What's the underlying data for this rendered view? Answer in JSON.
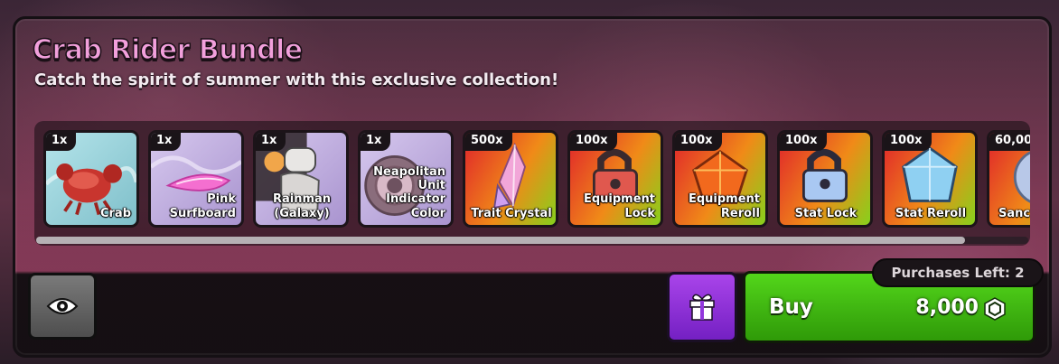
{
  "bundle": {
    "title": "Crab Rider Bundle",
    "subtitle": "Catch the spirit of summer with this exclusive collection!"
  },
  "items": [
    {
      "qty": "1x",
      "name": "Crab",
      "icon": "crab-icon",
      "bg": "#9fd2d8"
    },
    {
      "qty": "1x",
      "name": "Pink Surfboard",
      "icon": "surfboard-icon",
      "bg": "#c7b8e0"
    },
    {
      "qty": "1x",
      "name": "Rainman (Galaxy)",
      "icon": "rainman-unit-icon",
      "bg": "#c7b8e0"
    },
    {
      "qty": "1x",
      "name": "Neapolitan Unit Indicator Color",
      "icon": "unit-indicator-icon",
      "bg": "#c7b8e0"
    },
    {
      "qty": "500x",
      "name": "Trait Crystal",
      "icon": "crystal-icon",
      "bg": "rainbow"
    },
    {
      "qty": "100x",
      "name": "Equipment Lock",
      "icon": "lock-icon",
      "bg": "rainbow"
    },
    {
      "qty": "100x",
      "name": "Equipment Reroll",
      "icon": "reroll-gem-icon",
      "bg": "rainbow"
    },
    {
      "qty": "100x",
      "name": "Stat Lock",
      "icon": "stat-lock-icon",
      "bg": "rainbow"
    },
    {
      "qty": "100x",
      "name": "Stat Reroll",
      "icon": "stat-reroll-icon",
      "bg": "rainbow"
    },
    {
      "qty": "60,00",
      "name": "Sanc",
      "icon": "sand-dollar-icon",
      "bg": "rainbow"
    }
  ],
  "actions": {
    "view_icon": "eye-icon",
    "gift_icon": "gift-icon",
    "buy_label": "Buy",
    "price": "8,000",
    "currency_icon": "gem-coin-icon",
    "purchases_left": "Purchases Left: 2"
  },
  "colors": {
    "title": "#f2a0dc",
    "buy_green": "#45c013",
    "gift_purple": "#9236dc"
  }
}
